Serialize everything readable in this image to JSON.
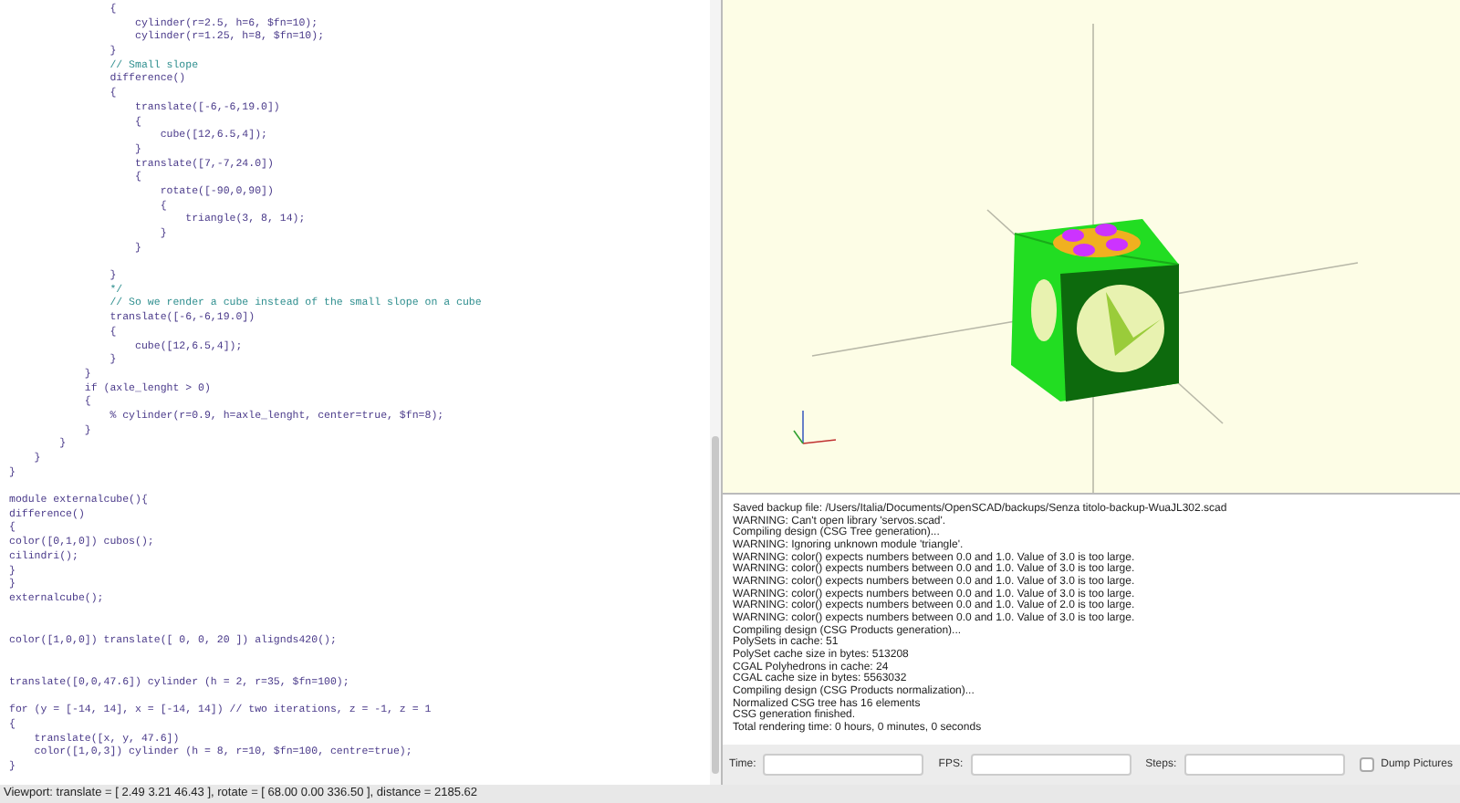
{
  "editor": {
    "lines": [
      {
        "kind": "code",
        "text": "                {"
      },
      {
        "kind": "code",
        "text": "                    cylinder(r=2.5, h=6, $fn=10);"
      },
      {
        "kind": "code",
        "text": "                    cylinder(r=1.25, h=8, $fn=10);"
      },
      {
        "kind": "code",
        "text": "                }"
      },
      {
        "kind": "comment",
        "text": "                // Small slope"
      },
      {
        "kind": "code",
        "text": "                difference()"
      },
      {
        "kind": "code",
        "text": "                {"
      },
      {
        "kind": "code",
        "text": "                    translate([-6,-6,19.0])"
      },
      {
        "kind": "code",
        "text": "                    {"
      },
      {
        "kind": "code",
        "text": "                        cube([12,6.5,4]);"
      },
      {
        "kind": "code",
        "text": "                    }"
      },
      {
        "kind": "code",
        "text": "                    translate([7,-7,24.0])"
      },
      {
        "kind": "code",
        "text": "                    {"
      },
      {
        "kind": "code",
        "text": "                        rotate([-90,0,90])"
      },
      {
        "kind": "code",
        "text": "                        {"
      },
      {
        "kind": "code",
        "text": "                            triangle(3, 8, 14);"
      },
      {
        "kind": "code",
        "text": "                        }"
      },
      {
        "kind": "code",
        "text": "                    }"
      },
      {
        "kind": "blank"
      },
      {
        "kind": "code",
        "text": "                }"
      },
      {
        "kind": "comment",
        "text": "                */"
      },
      {
        "kind": "comment",
        "text": "                // So we render a cube instead of the small slope on a cube"
      },
      {
        "kind": "code",
        "text": "                translate([-6,-6,19.0])"
      },
      {
        "kind": "code",
        "text": "                {"
      },
      {
        "kind": "code",
        "text": "                    cube([12,6.5,4]);"
      },
      {
        "kind": "code",
        "text": "                }"
      },
      {
        "kind": "code",
        "text": "            }"
      },
      {
        "kind": "code",
        "text": "            if (axle_lenght > 0)"
      },
      {
        "kind": "code",
        "text": "            {"
      },
      {
        "kind": "code",
        "text": "                % cylinder(r=0.9, h=axle_lenght, center=true, $fn=8);"
      },
      {
        "kind": "code",
        "text": "            }"
      },
      {
        "kind": "code",
        "text": "        }"
      },
      {
        "kind": "code",
        "text": "    }"
      },
      {
        "kind": "code",
        "text": "}"
      },
      {
        "kind": "blank"
      },
      {
        "kind": "code",
        "text": "module externalcube(){"
      },
      {
        "kind": "code",
        "text": "difference()"
      },
      {
        "kind": "code",
        "text": "{"
      },
      {
        "kind": "code",
        "text": "color([0,1,0]) cubos();"
      },
      {
        "kind": "code",
        "text": "cilindri();"
      },
      {
        "kind": "code",
        "text": "}"
      },
      {
        "kind": "code",
        "text": "}"
      },
      {
        "kind": "code",
        "text": "externalcube();"
      },
      {
        "kind": "blank"
      },
      {
        "kind": "blank"
      },
      {
        "kind": "code",
        "text": "color([1,0,0]) translate([ 0, 0, 20 ]) alignds420();"
      },
      {
        "kind": "blank"
      },
      {
        "kind": "blank"
      },
      {
        "kind": "code",
        "text": "translate([0,0,47.6]) cylinder (h = 2, r=35, $fn=100);"
      },
      {
        "kind": "blank"
      },
      {
        "kind": "code",
        "text": "for (y = [-14, 14], x = [-14, 14]) // two iterations, z = -1, z = 1"
      },
      {
        "kind": "code",
        "text": "{"
      },
      {
        "kind": "code",
        "text": "    translate([x, y, 47.6])"
      },
      {
        "kind": "code",
        "text": "    color([1,0,3]) cylinder (h = 8, r=10, $fn=100, centre=true);"
      },
      {
        "kind": "code",
        "text": "}"
      }
    ]
  },
  "console": {
    "lines": [
      "Saved backup file: /Users/Italia/Documents/OpenSCAD/backups/Senza titolo-backup-WuaJL302.scad",
      "WARNING: Can't open library 'servos.scad'.",
      "Compiling design (CSG Tree generation)...",
      "WARNING: Ignoring unknown module 'triangle'.",
      "WARNING: color() expects numbers between 0.0 and 1.0. Value of 3.0 is too large.",
      "WARNING: color() expects numbers between 0.0 and 1.0. Value of 3.0 is too large.",
      "WARNING: color() expects numbers between 0.0 and 1.0. Value of 3.0 is too large.",
      "WARNING: color() expects numbers between 0.0 and 1.0. Value of 3.0 is too large.",
      "WARNING: color() expects numbers between 0.0 and 1.0. Value of 2.0 is too large.",
      "WARNING: color() expects numbers between 0.0 and 1.0. Value of 3.0 is too large.",
      "Compiling design (CSG Products generation)...",
      "PolySets in cache: 51",
      "PolySet cache size in bytes: 513208",
      "CGAL Polyhedrons in cache: 24",
      "CGAL cache size in bytes: 5563032",
      "Compiling design (CSG Products normalization)...",
      "Normalized CSG tree has 16 elements",
      "CSG generation finished.",
      "Total rendering time: 0 hours, 0 minutes, 0 seconds"
    ]
  },
  "animate": {
    "time_label": "Time:",
    "fps_label": "FPS:",
    "steps_label": "Steps:",
    "dump_pictures": {
      "label": "Dump Pictures",
      "checked": false
    }
  },
  "status_bar": "Viewport: translate = [ 2.49 3.21 46.43 ], rotate = [ 68.00 0.00 336.50 ], distance = 2185.62"
}
